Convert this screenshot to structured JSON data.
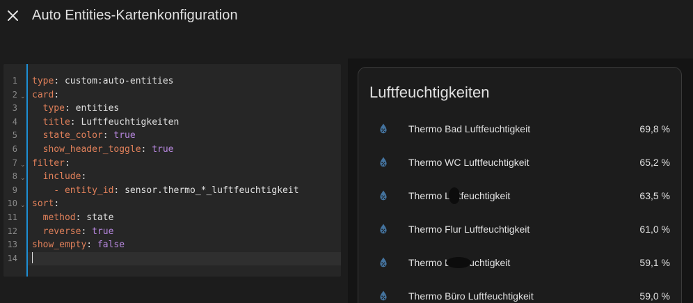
{
  "dialog": {
    "title": "Auto Entities-Kartenkonfiguration",
    "close_icon": "close-icon"
  },
  "editor": {
    "lines": [
      {
        "num": "1",
        "fold": false,
        "key": "type",
        "sep": ": ",
        "value": "custom:auto-entities",
        "vtype": "str",
        "indent": ""
      },
      {
        "num": "2",
        "fold": true,
        "key": "card",
        "sep": ":",
        "value": "",
        "vtype": "str",
        "indent": ""
      },
      {
        "num": "3",
        "fold": false,
        "key": "type",
        "sep": ": ",
        "value": "entities",
        "vtype": "str",
        "indent": "  "
      },
      {
        "num": "4",
        "fold": false,
        "key": "title",
        "sep": ": ",
        "value": "Luftfeuchtigkeiten",
        "vtype": "str",
        "indent": "  "
      },
      {
        "num": "5",
        "fold": false,
        "key": "state_color",
        "sep": ": ",
        "value": "true",
        "vtype": "bool",
        "indent": "  "
      },
      {
        "num": "6",
        "fold": false,
        "key": "show_header_toggle",
        "sep": ": ",
        "value": "true",
        "vtype": "bool",
        "indent": "  "
      },
      {
        "num": "7",
        "fold": true,
        "key": "filter",
        "sep": ":",
        "value": "",
        "vtype": "str",
        "indent": ""
      },
      {
        "num": "8",
        "fold": true,
        "key": "include",
        "sep": ":",
        "value": "",
        "vtype": "str",
        "indent": "  "
      },
      {
        "num": "9",
        "fold": false,
        "key": "entity_id",
        "sep": ": ",
        "value": "sensor.thermo_*_luftfeuchtigkeit",
        "vtype": "str",
        "indent": "    - "
      },
      {
        "num": "10",
        "fold": true,
        "key": "sort",
        "sep": ":",
        "value": "",
        "vtype": "str",
        "indent": ""
      },
      {
        "num": "11",
        "fold": false,
        "key": "method",
        "sep": ": ",
        "value": "state",
        "vtype": "str",
        "indent": "  "
      },
      {
        "num": "12",
        "fold": false,
        "key": "reverse",
        "sep": ": ",
        "value": "true",
        "vtype": "bool",
        "indent": "  "
      },
      {
        "num": "13",
        "fold": false,
        "key": "show_empty",
        "sep": ": ",
        "value": "false",
        "vtype": "bool",
        "indent": ""
      },
      {
        "num": "14",
        "fold": false,
        "key": "",
        "sep": "",
        "value": "",
        "vtype": "str",
        "indent": "",
        "active": true
      }
    ],
    "fold_icon": "chevron-down-icon"
  },
  "preview": {
    "card_title": "Luftfeuchtigkeiten",
    "icon": "water-percent-icon",
    "icon_color": "#44739e",
    "rows": [
      {
        "name": "Thermo Bad Luftfeuchtigkeit",
        "state": "69,8 %"
      },
      {
        "name": "Thermo WC Luftfeuchtigkeit",
        "state": "65,2 %"
      },
      {
        "name": "Thermo    Luftfeuchtigkeit",
        "state": "63,5 %"
      },
      {
        "name": "Thermo Flur Luftfeuchtigkeit",
        "state": "61,0 %"
      },
      {
        "name": "Thermo        Luftfeuchtigkeit",
        "state": "59,1 %"
      },
      {
        "name": "Thermo Büro Luftfeuchtigkeit",
        "state": "59,0 %"
      }
    ]
  }
}
